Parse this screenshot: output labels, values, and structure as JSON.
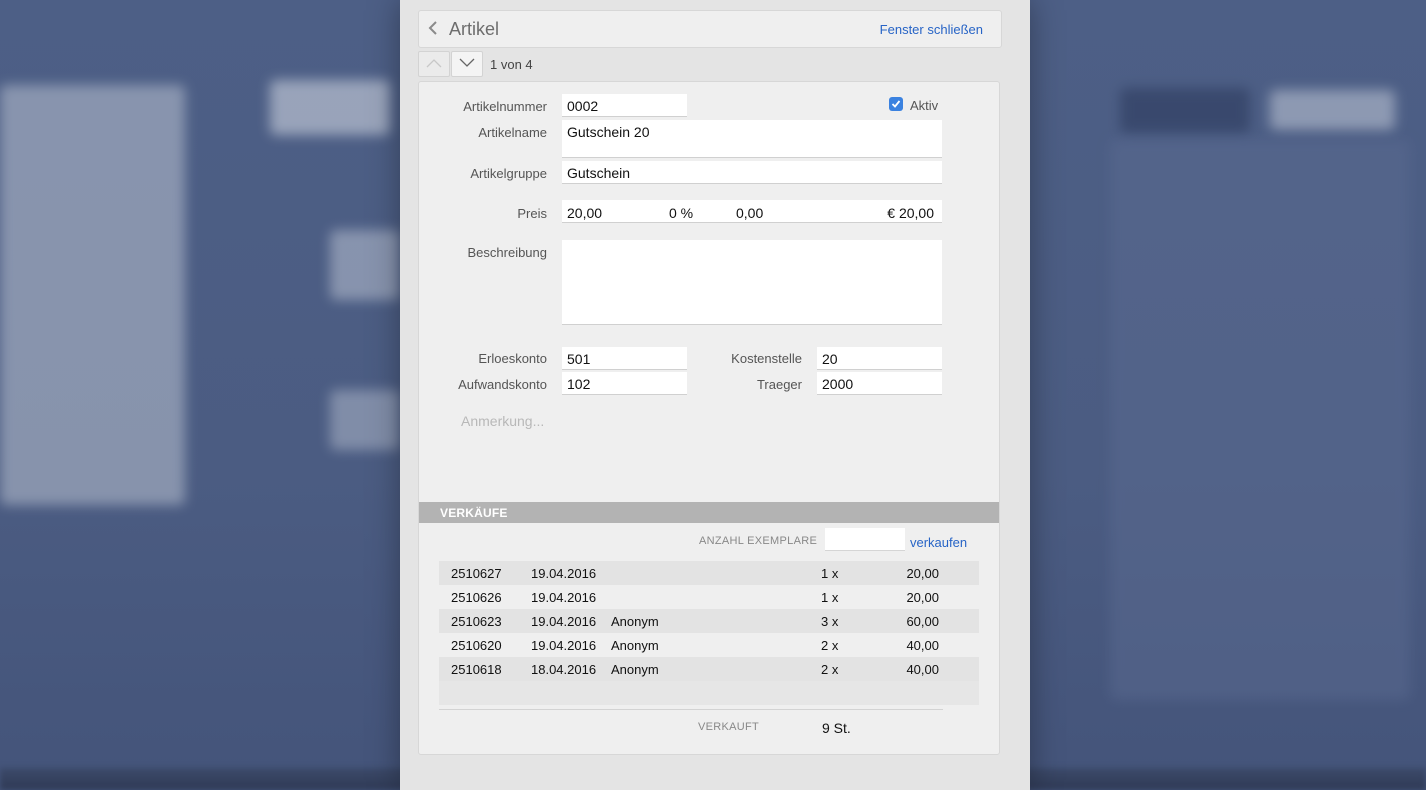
{
  "header": {
    "title": "Artikel",
    "close_label": "Fenster schließen"
  },
  "nav": {
    "counter": "1 von 4"
  },
  "form": {
    "artikelnummer_label": "Artikelnummer",
    "artikelnummer": "0002",
    "aktiv_label": "Aktiv",
    "aktiv_checked": true,
    "artikelname_label": "Artikelname",
    "artikelname": "Gutschein 20",
    "artikelgruppe_label": "Artikelgruppe",
    "artikelgruppe": "Gutschein",
    "preis_label": "Preis",
    "preis": "20,00",
    "steuer_prozent": "0 %",
    "steuer_betrag": "0,00",
    "preis_gesamt": "€ 20,00",
    "beschreibung_label": "Beschreibung",
    "beschreibung": "",
    "erloeskonto_label": "Erloeskonto",
    "erloeskonto": "501",
    "kostenstelle_label": "Kostenstelle",
    "kostenstelle": "20",
    "aufwandskonto_label": "Aufwandskonto",
    "aufwandskonto": "102",
    "traeger_label": "Traeger",
    "traeger": "2000",
    "anmerkung_placeholder": "Anmerkung..."
  },
  "verkaeufe": {
    "section_title": "VERKÄUFE",
    "anzahl_label": "ANZAHL EXEMPLARE",
    "anzahl_value": "",
    "sell_label": "verkaufen",
    "rows": [
      {
        "nr": "2510627",
        "datum": "19.04.2016",
        "kunde": "",
        "menge": "1 x",
        "betrag": "20,00"
      },
      {
        "nr": "2510626",
        "datum": "19.04.2016",
        "kunde": "",
        "menge": "1 x",
        "betrag": "20,00"
      },
      {
        "nr": "2510623",
        "datum": "19.04.2016",
        "kunde": "Anonym",
        "menge": "3 x",
        "betrag": "60,00"
      },
      {
        "nr": "2510620",
        "datum": "19.04.2016",
        "kunde": "Anonym",
        "menge": "2 x",
        "betrag": "40,00"
      },
      {
        "nr": "2510618",
        "datum": "18.04.2016",
        "kunde": "Anonym",
        "menge": "2 x",
        "betrag": "40,00"
      }
    ],
    "verkauft_label": "VERKAUFT",
    "verkauft_value": "9 St."
  },
  "colors": {
    "accent": "#2764c6",
    "checkbox": "#3b82e0",
    "section_bar": "#b3b3b3"
  },
  "icons": {
    "back": "chevron-left-icon",
    "nav_up": "chevron-up-icon",
    "nav_down": "chevron-down-icon",
    "check": "checkmark-icon"
  }
}
